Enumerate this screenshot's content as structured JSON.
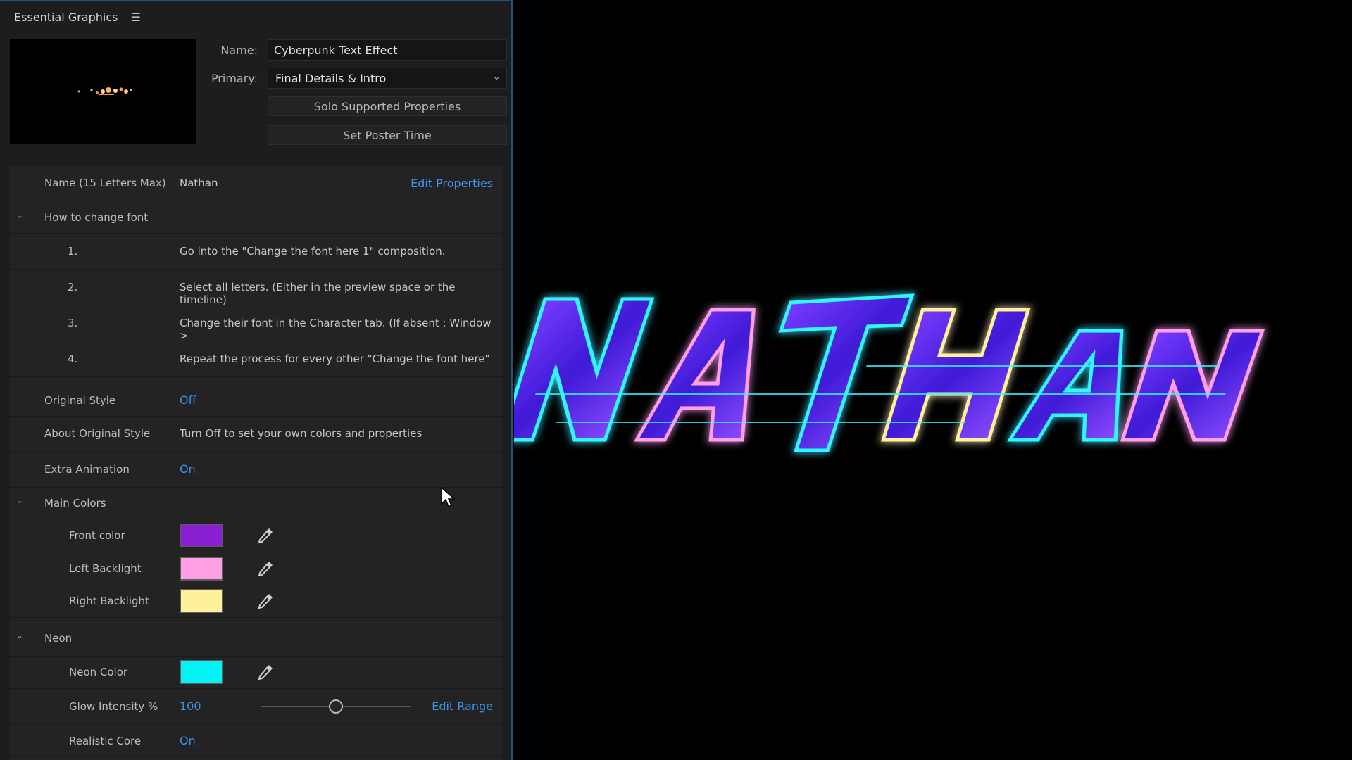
{
  "panel": {
    "title": "Essential Graphics",
    "name_label": "Name:",
    "name_value": "Cyberpunk Text Effect",
    "primary_label": "Primary:",
    "primary_value": "Final Details & Intro",
    "solo_button": "Solo Supported Properties",
    "poster_button": "Set Poster Time"
  },
  "properties": {
    "name_field": {
      "label": "Name (15 Letters Max)",
      "value": "Nathan",
      "link": "Edit Properties"
    },
    "font_section": {
      "title": "How to change font",
      "steps": [
        {
          "num": "1.",
          "text": "Go into the \"Change the font here 1\" composition."
        },
        {
          "num": "2.",
          "text": "Select all letters. (Either in the preview space or the timeline)"
        },
        {
          "num": "3.",
          "text": "Change their font in the Character tab. (If absent : Window >"
        },
        {
          "num": "4.",
          "text": "Repeat the process for every other \"Change the font here\""
        }
      ]
    },
    "original_style": {
      "label": "Original Style",
      "value": "Off"
    },
    "about_original": {
      "label": "About Original Style",
      "value": "Turn Off to set your own colors and properties"
    },
    "extra_animation": {
      "label": "Extra Animation",
      "value": "On"
    },
    "main_colors": {
      "title": "Main Colors",
      "items": [
        {
          "label": "Front color",
          "color": "#8a1fd4"
        },
        {
          "label": "Left Backlight",
          "color": "#ff9fe6"
        },
        {
          "label": "Right Backlight",
          "color": "#fff09a"
        }
      ]
    },
    "neon": {
      "title": "Neon",
      "color_label": "Neon Color",
      "color": "#00f4f4",
      "glow_label": "Glow Intensity %",
      "glow_value": "100",
      "glow_fraction": 0.5,
      "edit_range": "Edit Range",
      "core_label": "Realistic Core",
      "core_value": "On"
    }
  },
  "colors": {
    "accent": "#3b91e8",
    "panel_bg": "#1d1d1d",
    "neon_cyan": "#33f6ff",
    "text_purple": "#5b2cff"
  }
}
